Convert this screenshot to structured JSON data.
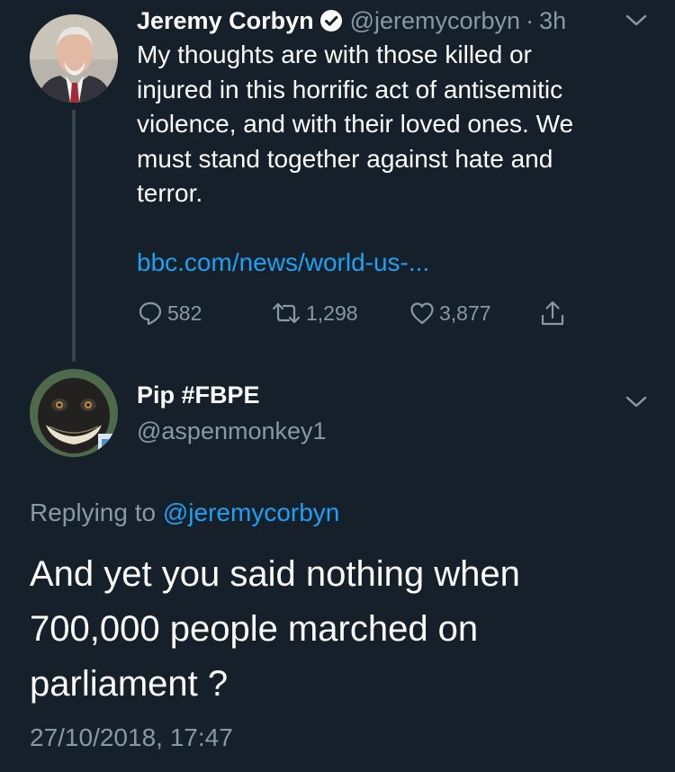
{
  "parent_tweet": {
    "author_name": "Jeremy Corbyn",
    "handle": "@jeremycorbyn",
    "separator": "·",
    "time_ago": "3h",
    "text_lines": "My thoughts are with those killed or\ninjured in this horrific act of antisemitic\nviolence, and with their loved ones. We\nmust stand together against hate and\nterror.",
    "link": "bbc.com/news/world-us-...",
    "replies": "582",
    "retweets": "1,298",
    "likes": "3,877",
    "verified": true
  },
  "reply_tweet": {
    "author_name": "Pip #FBPE",
    "handle": "@aspenmonkey1",
    "replying_prefix": "Replying to",
    "replying_to": "@jeremycorbyn",
    "text_lines": "And yet you said nothing when\n700,000 people marched on\nparliament ?",
    "timestamp": "27/10/2018, 17:47"
  },
  "icons": {
    "verified": "verified-badge-icon",
    "more": "chevron-down-icon",
    "reply": "reply-icon",
    "retweet": "retweet-icon",
    "like": "heart-icon",
    "share": "share-icon"
  },
  "colors": {
    "background": "#15202b",
    "text": "#ffffff",
    "secondary": "#8899a6",
    "link": "#1da1f2",
    "thread_line": "#38444d"
  }
}
